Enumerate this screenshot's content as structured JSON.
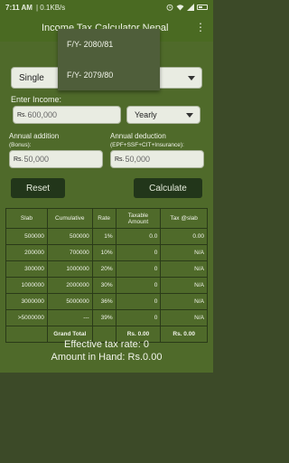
{
  "status_bar": {
    "time": "7:11 AM",
    "network": "| 0.1KB/s"
  },
  "app_bar": {
    "title": "Income Tax Calculator Nepal"
  },
  "dropdown": {
    "items": [
      "F/Y- 2080/81",
      "F/Y- 2079/80"
    ]
  },
  "form": {
    "status_select": "Single",
    "income_label": "Enter Income:",
    "income_prefix": "Rs.",
    "income_value": "600,000",
    "period": "Yearly",
    "addition_label": "Annual addition",
    "addition_sub": "(Bonus):",
    "addition_prefix": "Rs.",
    "addition_value": "50,000",
    "deduction_label": "Annual deduction",
    "deduction_sub": "(EPF+SSF+CIT+Insurance):",
    "deduction_prefix": "Rs.",
    "deduction_value": "50,000",
    "reset_label": "Reset",
    "calculate_label": "Calculate"
  },
  "table": {
    "headers": [
      "Slab",
      "Cumulative",
      "Rate",
      "Taxable Amount",
      "Tax @slab"
    ],
    "rows": [
      [
        "500000",
        "500000",
        "1%",
        "0.0",
        "0.00"
      ],
      [
        "200000",
        "700000",
        "10%",
        "0",
        "N/A"
      ],
      [
        "300000",
        "1000000",
        "20%",
        "0",
        "N/A"
      ],
      [
        "1000000",
        "2000000",
        "30%",
        "0",
        "N/A"
      ],
      [
        "3000000",
        "5000000",
        "36%",
        "0",
        "N/A"
      ],
      [
        ">5000000",
        "---",
        "39%",
        "0",
        "N/A"
      ]
    ],
    "footer": [
      "",
      "Grand Total",
      "",
      "Rs. 0.00",
      "Rs. 0.00"
    ]
  },
  "results": {
    "effective_rate": "Effective tax rate: 0",
    "amount_in_hand": "Amount in Hand: Rs.0.00"
  }
}
